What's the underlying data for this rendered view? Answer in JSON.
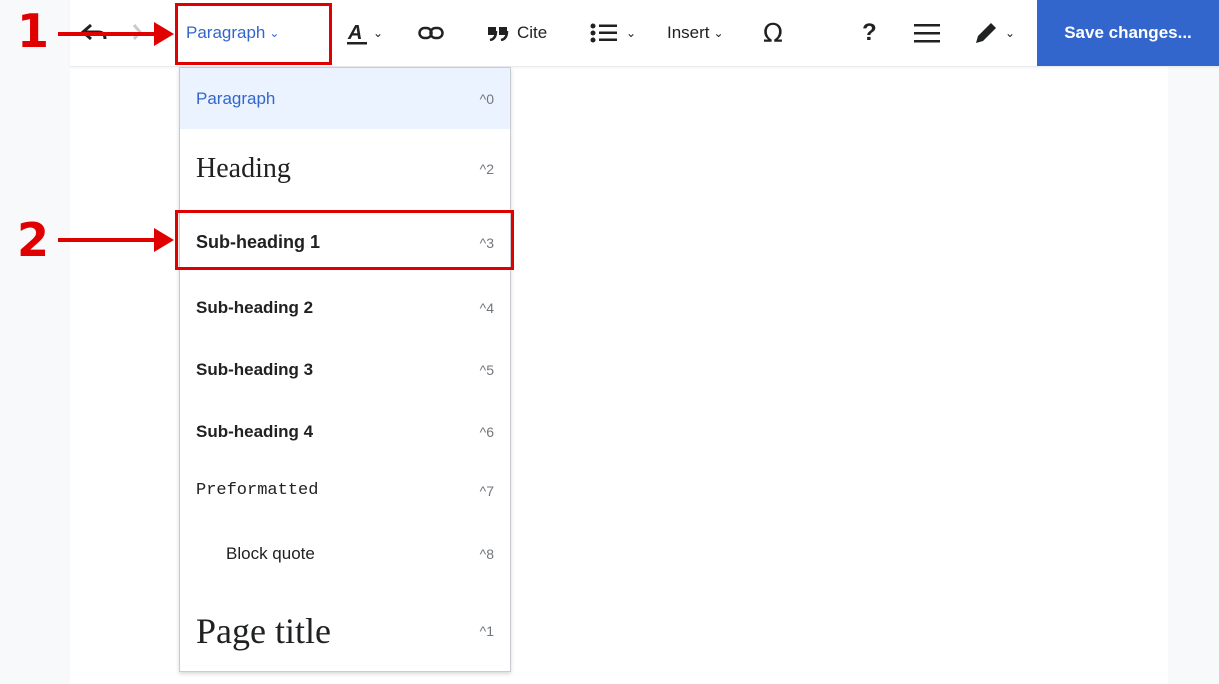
{
  "toolbar": {
    "paragraph_label": "Paragraph",
    "cite_label": "Cite",
    "insert_label": "Insert",
    "help_label": "?",
    "save_label": "Save changes..."
  },
  "menu": {
    "items": [
      {
        "label": "Paragraph",
        "shortcut": "^0"
      },
      {
        "label": "Heading",
        "shortcut": "^2"
      },
      {
        "label": "Sub-heading 1",
        "shortcut": "^3"
      },
      {
        "label": "Sub-heading 2",
        "shortcut": "^4"
      },
      {
        "label": "Sub-heading 3",
        "shortcut": "^5"
      },
      {
        "label": "Sub-heading 4",
        "shortcut": "^6"
      },
      {
        "label": "Preformatted",
        "shortcut": "^7"
      },
      {
        "label": "Block quote",
        "shortcut": "^8"
      },
      {
        "label": "Page title",
        "shortcut": "^1"
      }
    ]
  },
  "annotations": {
    "step1": "1",
    "step2": "2"
  },
  "colors": {
    "accent": "#3366cc",
    "annotation_red": "#e00000",
    "selected_bg": "#eaf3ff"
  }
}
